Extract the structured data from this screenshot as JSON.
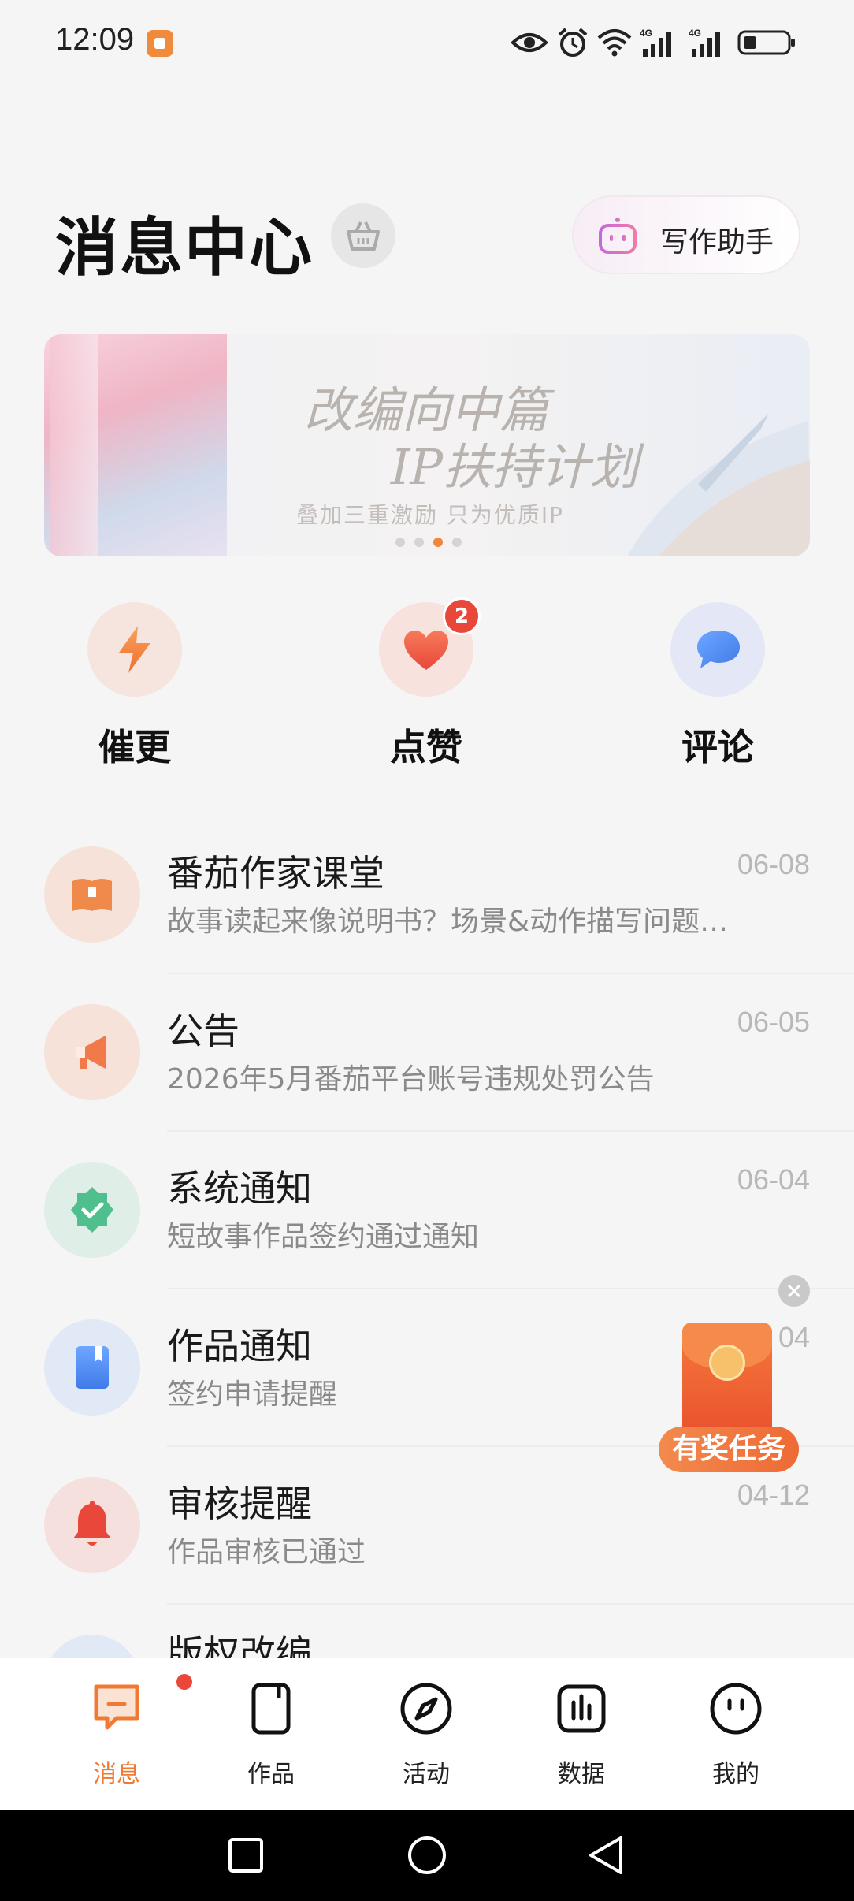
{
  "status_bar": {
    "time": "12:09"
  },
  "header": {
    "title": "消息中心",
    "assistant_label": "写作助手"
  },
  "banner": {
    "title_line1": "改编向中篇",
    "title_line2": "IP扶持计划",
    "subtitle": "叠加三重激励 只为优质IP",
    "active_page": 3,
    "page_count": 4
  },
  "quick_actions": [
    {
      "label": "催更",
      "icon": "lightning-icon"
    },
    {
      "label": "点赞",
      "icon": "heart-icon",
      "badge": "2"
    },
    {
      "label": "评论",
      "icon": "chat-bubble-icon"
    }
  ],
  "messages": [
    {
      "title": "番茄作家课堂",
      "date": "06-08",
      "subtitle": "故事读起来像说明书？场景&动作描写问题…",
      "icon": "book-icon",
      "color": "#f08a4a"
    },
    {
      "title": "公告",
      "date": "06-05",
      "subtitle": "2026年5月番茄平台账号违规处罚公告",
      "icon": "megaphone-icon",
      "color": "#f07a4a"
    },
    {
      "title": "系统通知",
      "date": "06-04",
      "subtitle": "短故事作品签约通过通知",
      "icon": "verified-badge-icon",
      "color": "#4fc08d"
    },
    {
      "title": "作品通知",
      "date": "04",
      "subtitle": "签约申请提醒",
      "icon": "bookmark-book-icon",
      "color": "#4f8ef7"
    },
    {
      "title": "审核提醒",
      "date": "04-12",
      "subtitle": "作品审核已通过",
      "icon": "bell-icon",
      "color": "#e8473a"
    },
    {
      "title": "版权改编"
    }
  ],
  "reward": {
    "label": "有奖任务"
  },
  "bottom_nav": [
    {
      "label": "消息",
      "icon": "message-icon",
      "active": true
    },
    {
      "label": "作品",
      "icon": "works-icon"
    },
    {
      "label": "活动",
      "icon": "compass-icon"
    },
    {
      "label": "数据",
      "icon": "chart-icon"
    },
    {
      "label": "我的",
      "icon": "profile-icon"
    }
  ],
  "colors": {
    "accent": "#f07a33",
    "badge": "#e8473a"
  }
}
